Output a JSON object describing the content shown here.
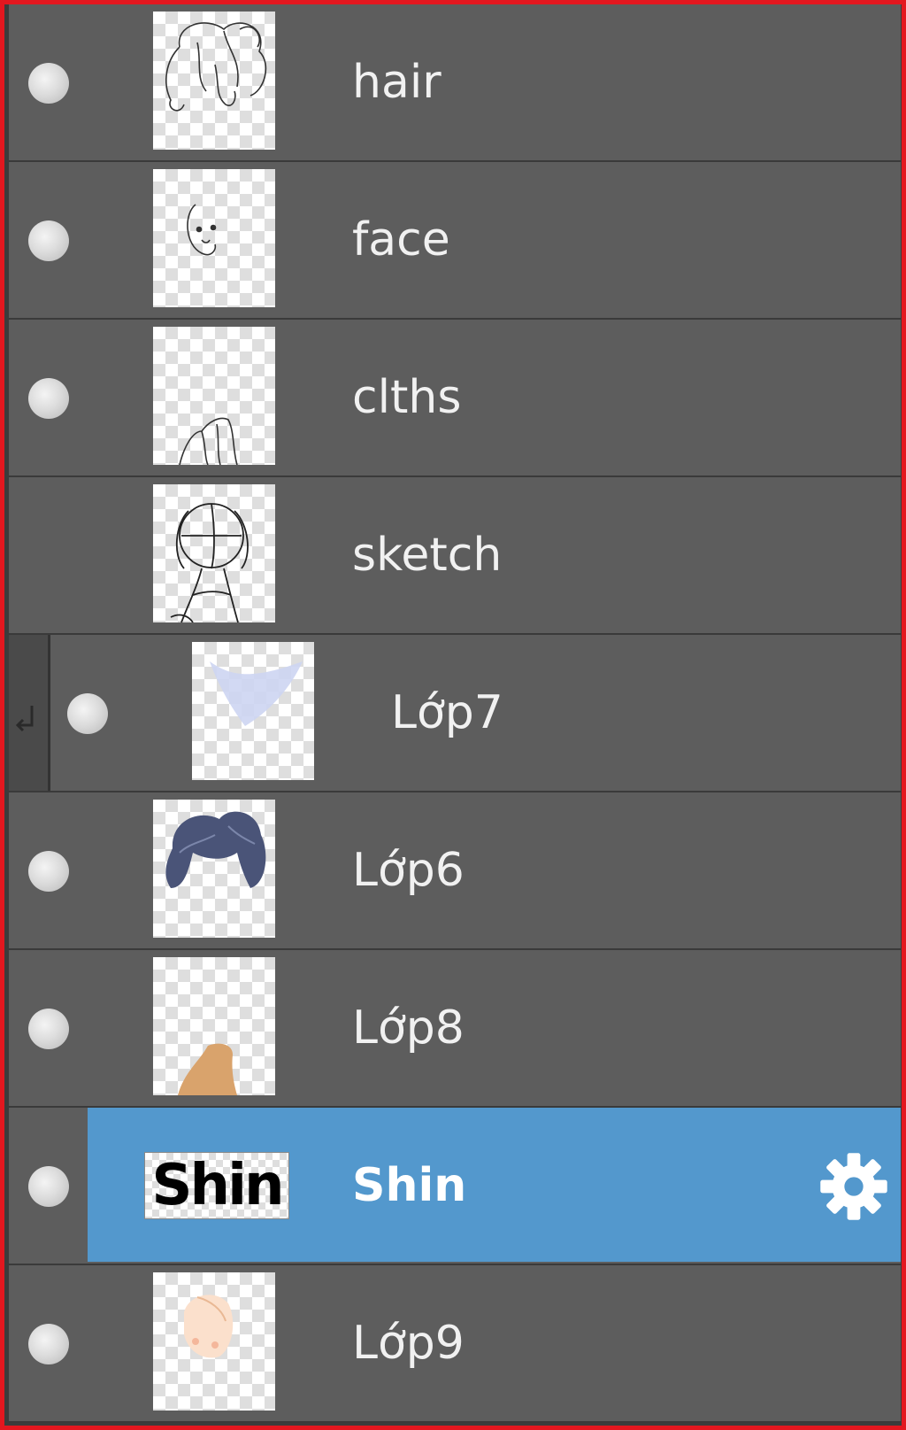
{
  "layers_panel": {
    "layers": [
      {
        "name": "hair",
        "visible_dot": true,
        "clipped": false,
        "selected": false,
        "thumb": "hair-line-sketch"
      },
      {
        "name": "face",
        "visible_dot": true,
        "clipped": false,
        "selected": false,
        "thumb": "face-line-sketch"
      },
      {
        "name": "clths",
        "visible_dot": true,
        "clipped": false,
        "selected": false,
        "thumb": "clothes-line-sketch"
      },
      {
        "name": "sketch",
        "visible_dot": false,
        "clipped": false,
        "selected": false,
        "thumb": "figure-sketch"
      },
      {
        "name": "Lớp7",
        "visible_dot": true,
        "clipped": true,
        "selected": false,
        "thumb": "light-blue-shading"
      },
      {
        "name": "Lớp6",
        "visible_dot": true,
        "clipped": false,
        "selected": false,
        "thumb": "dark-blue-hair"
      },
      {
        "name": "Lớp8",
        "visible_dot": true,
        "clipped": false,
        "selected": false,
        "thumb": "tan-shape"
      },
      {
        "name": "Shin",
        "visible_dot": true,
        "clipped": false,
        "selected": true,
        "thumb_text": "Shin",
        "thumb": "text-layer"
      },
      {
        "name": "Lớp9",
        "visible_dot": true,
        "clipped": false,
        "selected": false,
        "thumb": "skin-face"
      }
    ]
  },
  "colors": {
    "panel_bg": "#5d5d5d",
    "selected_bg": "#5398cd",
    "border_highlight": "#e3171f"
  },
  "icons": {
    "visibility": "visibility-dot-icon",
    "settings": "gear-icon",
    "clipping": "clipping-arrow-icon"
  }
}
